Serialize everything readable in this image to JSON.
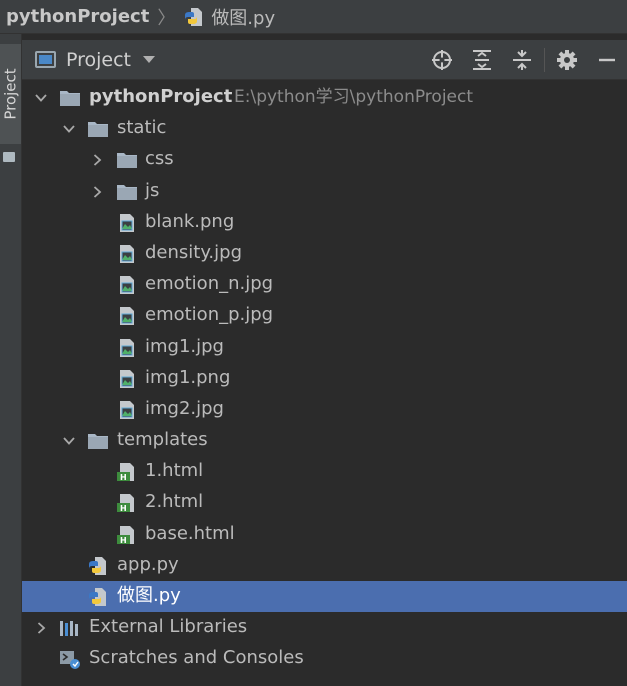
{
  "breadcrumb": {
    "project": "pythonProject",
    "file": "做图.py"
  },
  "stripe": {
    "tab_label": "Project"
  },
  "header": {
    "title": "Project",
    "tools": [
      "locate-icon",
      "expand-all-icon",
      "collapse-all-icon",
      "gear-icon",
      "minimize-icon"
    ]
  },
  "tree": {
    "root": {
      "name": "pythonProject",
      "path": "E:\\python学习\\pythonProject"
    },
    "static": "static",
    "css": "css",
    "js": "js",
    "blank": "blank.png",
    "density": "density.jpg",
    "emotion_n": "emotion_n.jpg",
    "emotion_p": "emotion_p.jpg",
    "img1jpg": "img1.jpg",
    "img1png": "img1.png",
    "img2": "img2.jpg",
    "templates": "templates",
    "html1": "1.html",
    "html2": "2.html",
    "base": "base.html",
    "app": "app.py",
    "zuotu": "做图.py",
    "ext_libs": "External Libraries",
    "scratches": "Scratches and Consoles"
  },
  "colors": {
    "background": "#2b2b2b",
    "panel": "#3c3f41",
    "selection": "#4b6eaf",
    "folder": "#a9b7c6",
    "image_icon_accent": "#499c54",
    "html_icon_accent": "#3d8c3d"
  }
}
